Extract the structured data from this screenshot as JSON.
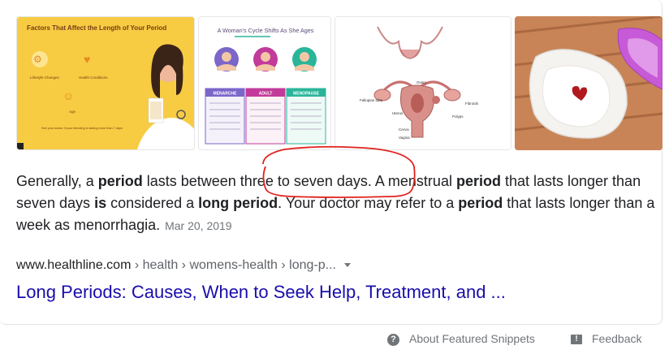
{
  "images": [
    {
      "name": "factors-infographic",
      "title": "Factors That Affect the Length of Your Period",
      "labels": [
        "Lifestyle Changes",
        "Health Conditions",
        "Age"
      ],
      "caption": "See your doctor if your bleeding is lasting more than 7 days"
    },
    {
      "name": "cycle-shifts-infographic",
      "title": "A Woman's Cycle Shifts As She Ages",
      "columns": [
        "MENARCHE",
        "ADULT",
        "MENOPAUSE"
      ]
    },
    {
      "name": "uterus-diagram",
      "labels": [
        "Ovary",
        "Fallopian tube",
        "Fibroids",
        "Uterus",
        "Polyps",
        "Cervix",
        "Vagina"
      ]
    },
    {
      "name": "pad-photo"
    }
  ],
  "snippet": {
    "segments": [
      {
        "text": "Generally, a ",
        "bold": false
      },
      {
        "text": "period",
        "bold": true
      },
      {
        "text": " lasts between three to seven days. A menstrual ",
        "bold": false
      },
      {
        "text": "period",
        "bold": true
      },
      {
        "text": " that lasts longer than seven days ",
        "bold": false
      },
      {
        "text": "is",
        "bold": true
      },
      {
        "text": " considered a ",
        "bold": false
      },
      {
        "text": "long period",
        "bold": true
      },
      {
        "text": ". Your doctor may refer to a ",
        "bold": false
      },
      {
        "text": "period",
        "bold": true
      },
      {
        "text": " that lasts longer than a week as menorrhagia.",
        "bold": false
      }
    ],
    "date": "Mar 20, 2019"
  },
  "result": {
    "domain": "www.healthline.com",
    "crumbs": " › health › womens-health › long-p...",
    "title": "Long Periods: Causes, When to Seek Help, Treatment, and ..."
  },
  "footer": {
    "about": "About Featured Snippets",
    "feedback": "Feedback"
  },
  "colors": {
    "link": "#1a0dab",
    "annotation": "#e0221e",
    "infographic_yellow": "#f7cc43"
  }
}
